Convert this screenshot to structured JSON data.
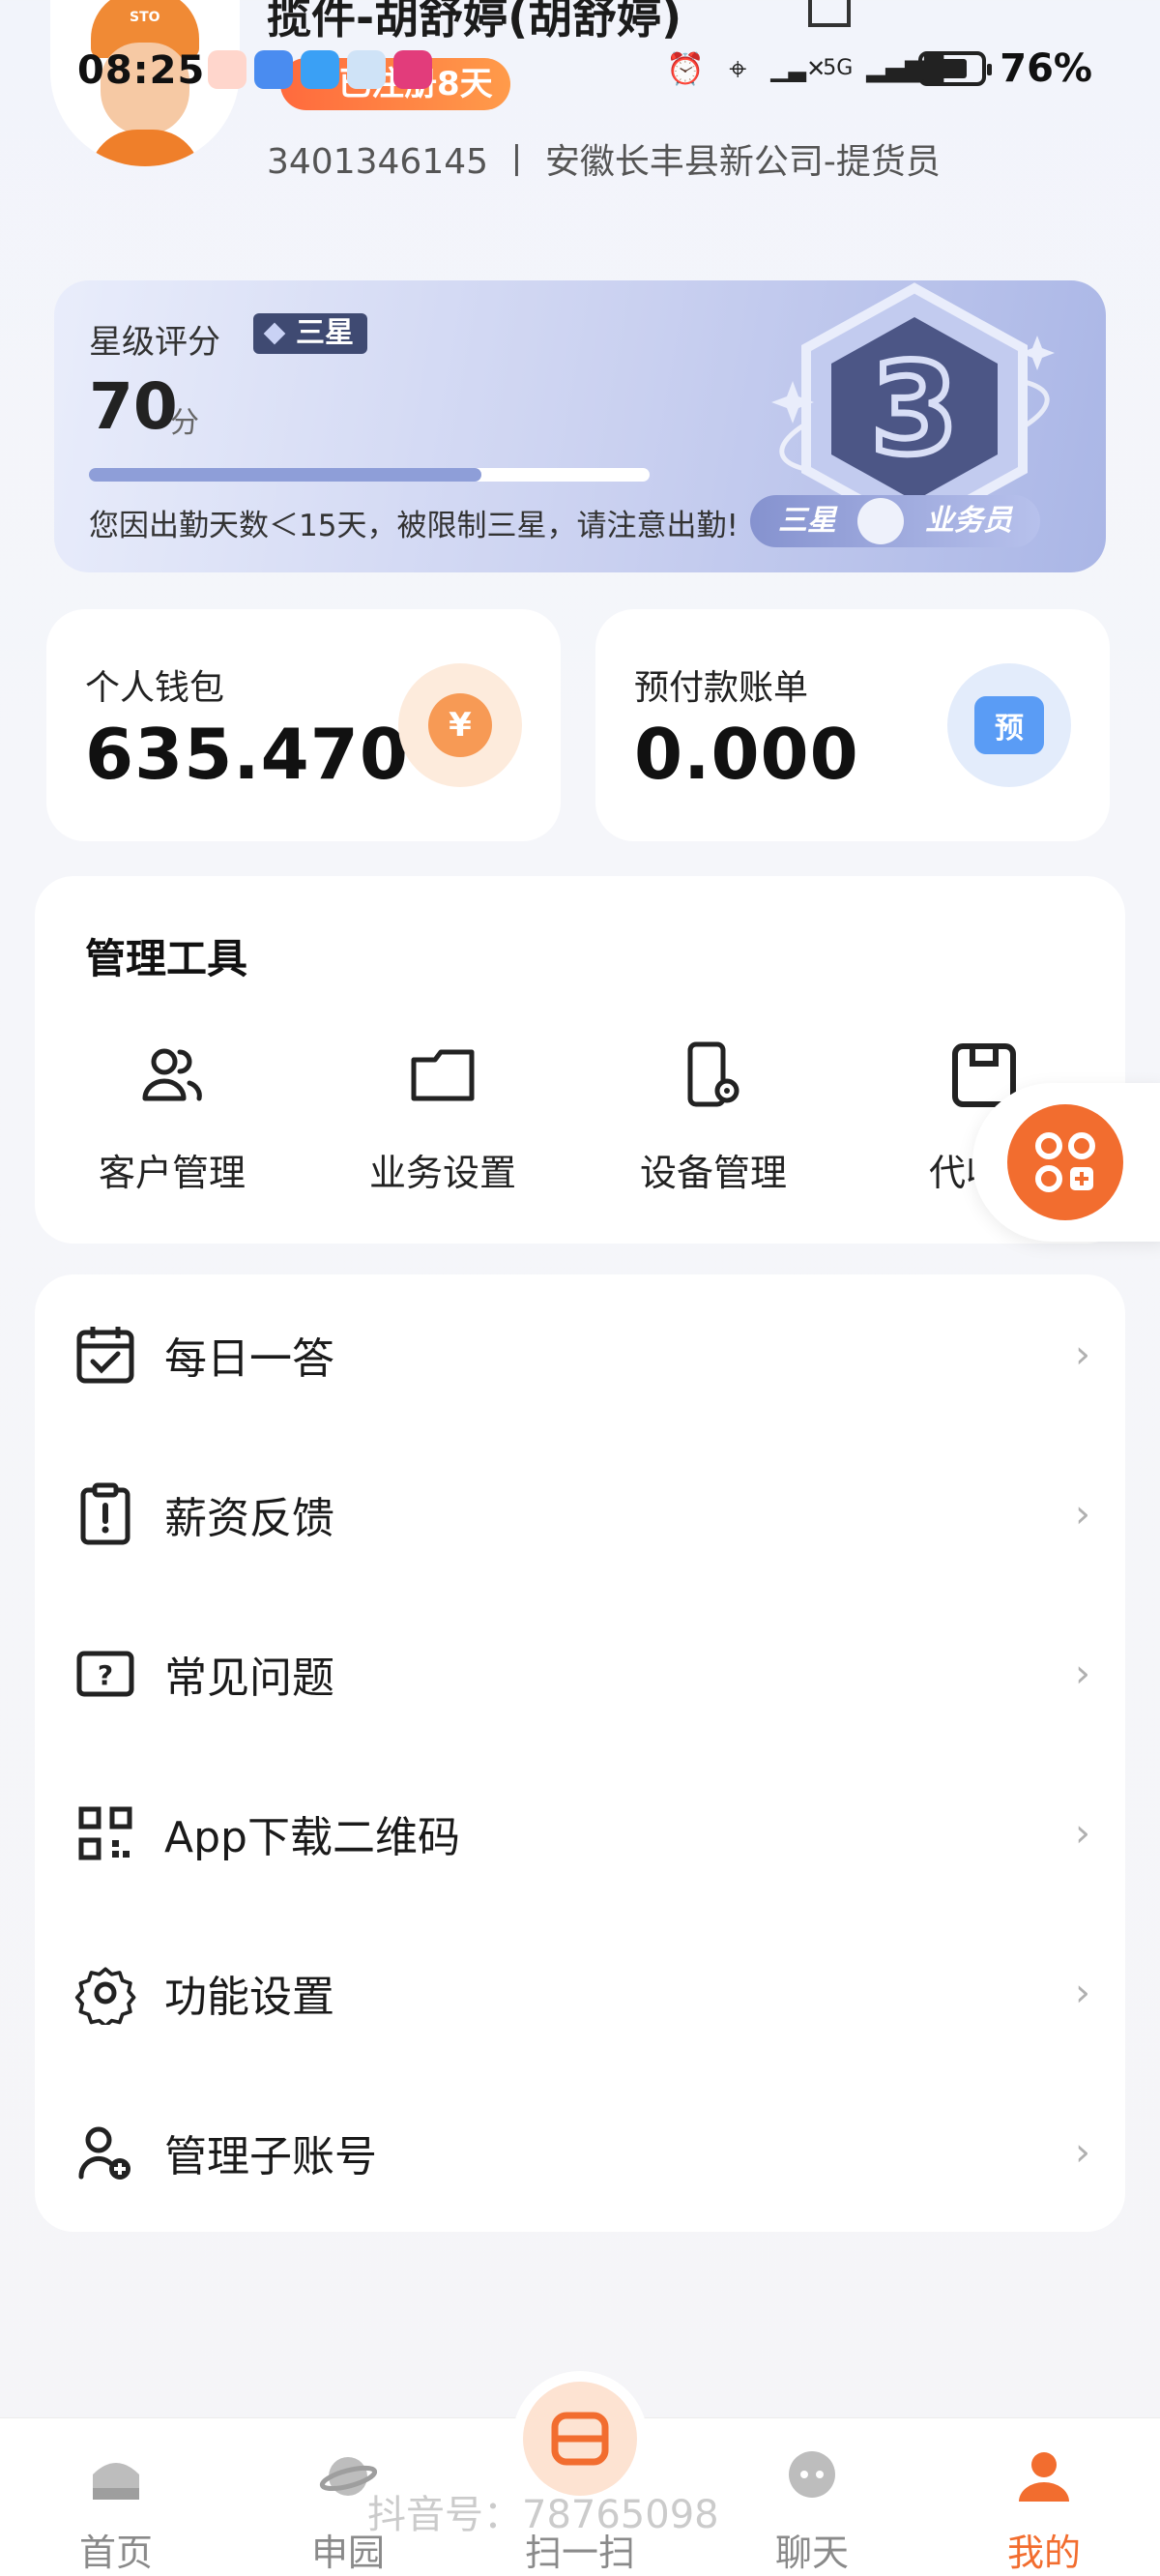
{
  "status_bar": {
    "time": "08:25",
    "battery": "76%",
    "network": "5G"
  },
  "profile": {
    "name": "揽件-胡舒婷(胡舒婷)",
    "joined_badge": "已注册8天",
    "subtitle": "3401346145 丨 安徽长丰县新公司-提货员",
    "avatar_text": "STO"
  },
  "rating": {
    "title": "星级评分",
    "tag": "三星",
    "score": "70",
    "unit": "分",
    "progress": 0.7,
    "note": "您因出勤天数＜15天，被限制三星，请注意出勤!",
    "badge_number": "3",
    "badge_level": "三星",
    "badge_role": "业务员"
  },
  "wallets": [
    {
      "label": "个人钱包",
      "value": "635.470",
      "icon_text": "¥"
    },
    {
      "label": "预付款账单",
      "value": "0.000",
      "icon_text": "预"
    }
  ],
  "tools": {
    "title": "管理工具",
    "items": [
      {
        "label": "客户管理",
        "icon": "customers-icon"
      },
      {
        "label": "业务设置",
        "icon": "folder-icon"
      },
      {
        "label": "设备管理",
        "icon": "device-settings-icon"
      },
      {
        "label": "代收管",
        "icon": "package-icon"
      }
    ]
  },
  "menu": [
    {
      "label": "每日一答",
      "icon": "calendar-check-icon"
    },
    {
      "label": "薪资反馈",
      "icon": "clipboard-alert-icon"
    },
    {
      "label": "常见问题",
      "icon": "question-icon"
    },
    {
      "label": "App下载二维码",
      "icon": "qr-code-icon"
    },
    {
      "label": "功能设置",
      "icon": "gear-icon"
    },
    {
      "label": "管理子账号",
      "icon": "add-user-icon"
    }
  ],
  "bottom_nav": [
    {
      "label": "首页",
      "icon": "home-icon"
    },
    {
      "label": "申园",
      "icon": "planet-icon"
    },
    {
      "label": "扫一扫",
      "icon": "scan-icon"
    },
    {
      "label": "聊天",
      "icon": "chat-icon"
    },
    {
      "label": "我的",
      "icon": "profile-icon",
      "active": true
    }
  ],
  "watermark": "抖音号：78765098",
  "colors": {
    "accent": "#f26d2f",
    "rating_card": "#c9d0f0",
    "rating_tag": "#3f4a72"
  }
}
